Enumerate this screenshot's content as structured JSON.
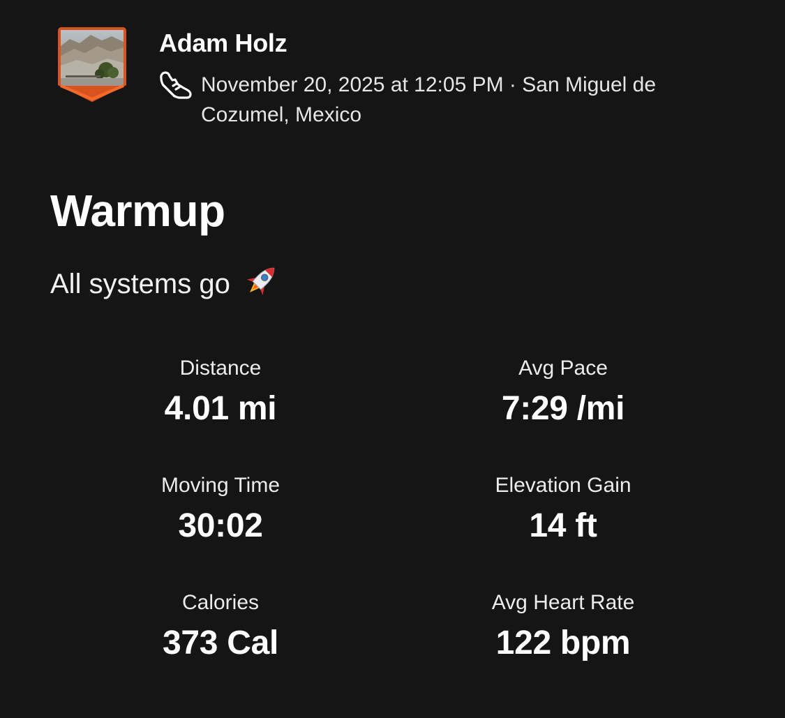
{
  "athlete": {
    "name": "Adam Holz",
    "avatar_icon": "mountain-photo-avatar",
    "sport_icon": "running-shoe-icon"
  },
  "activity": {
    "meta": "November 20, 2025 at 12:05 PM · San Miguel de Cozumel, Mexico",
    "title": "Warmup",
    "description": "All systems go",
    "description_icon": "rocket-icon"
  },
  "stats": [
    {
      "label": "Distance",
      "value": "4.01 mi"
    },
    {
      "label": "Avg Pace",
      "value": "7:29 /mi"
    },
    {
      "label": "Moving Time",
      "value": "30:02"
    },
    {
      "label": "Elevation Gain",
      "value": "14 ft"
    },
    {
      "label": "Calories",
      "value": "373 Cal"
    },
    {
      "label": "Avg Heart Rate",
      "value": "122 bpm"
    }
  ],
  "colors": {
    "background": "#151515",
    "text": "#ffffff",
    "accent": "#fc4c02"
  }
}
